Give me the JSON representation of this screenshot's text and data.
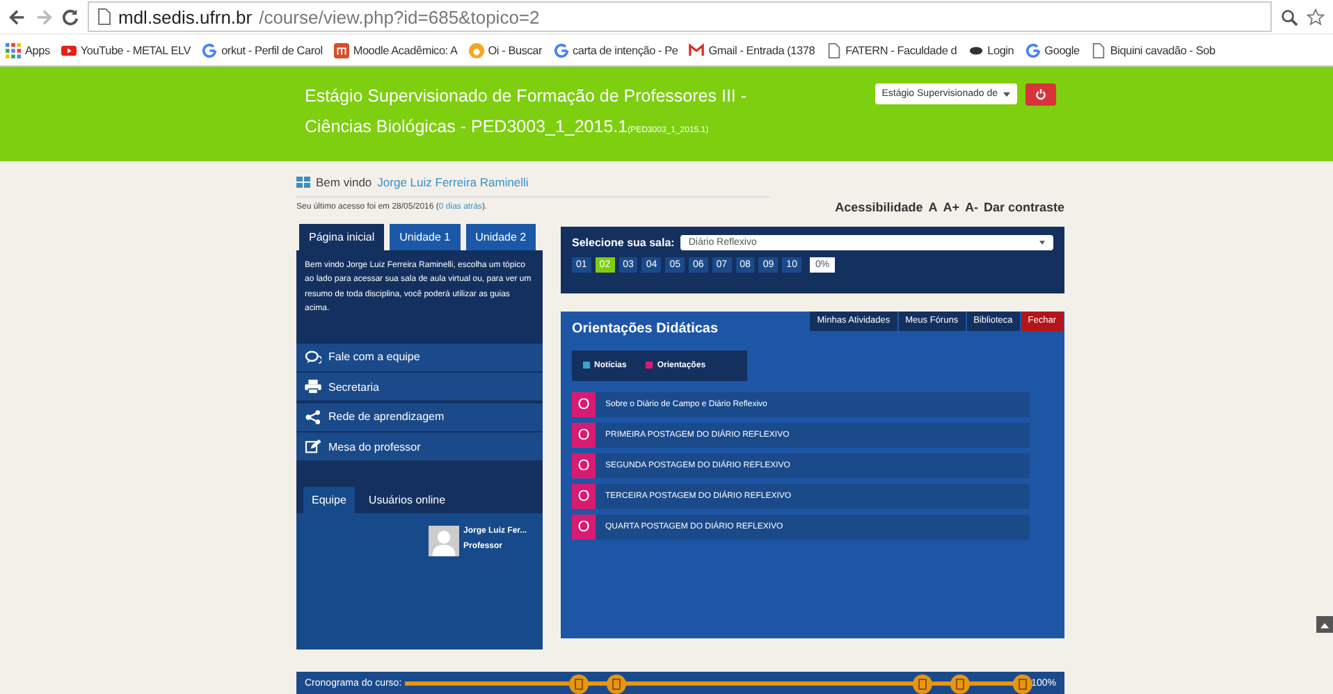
{
  "browser": {
    "url_host": "mdl.sedis.ufrn.br",
    "url_path": "/course/view.php?id=685&topico=2",
    "bookmarks": [
      {
        "kind": "apps",
        "label": "Apps"
      },
      {
        "kind": "youtube",
        "label": "YouTube - METAL ELV"
      },
      {
        "kind": "google",
        "label": "orkut - Perfil de Carol"
      },
      {
        "kind": "moodle",
        "label": "Moodle Acadêmico: A"
      },
      {
        "kind": "oi",
        "label": "Oi - Buscar"
      },
      {
        "kind": "google",
        "label": "carta de intenção - Pe"
      },
      {
        "kind": "gmail",
        "label": "Gmail - Entrada (1378"
      },
      {
        "kind": "page",
        "label": "FATERN - Faculdade d"
      },
      {
        "kind": "login",
        "label": "Login"
      },
      {
        "kind": "google",
        "label": "Google"
      },
      {
        "kind": "page",
        "label": "Biquini cavadão - Sob"
      }
    ]
  },
  "header": {
    "title": "Estágio Supervisionado de Formação de Professores III - Ciências Biológicas - PED3003_1_2015.1",
    "code": "(PED3003_1_2015.1)",
    "course_select": "Estágio Supervisionado de"
  },
  "welcome": {
    "prefix": "Bem vindo",
    "name": "Jorge Luiz Ferreira Raminelli",
    "last_access": "Seu último acesso foi em 28/05/2016 (",
    "last_access_link": "0 dias atrás",
    "last_access_end": ")."
  },
  "accessibility": [
    "Acessibilidade",
    "A",
    "A+",
    "A-",
    "Dar contraste"
  ],
  "left_tabs": [
    {
      "label": "Página inicial",
      "selected": true
    },
    {
      "label": "Unidade 1",
      "selected": false
    },
    {
      "label": "Unidade 2",
      "selected": false
    }
  ],
  "intro": "Bem vindo Jorge Luiz Ferreira Raminelli, escolha um tópico ao lado para acessar sua sala de aula virtual ou, para ver um resumo de toda disciplina, você poderá utilizar as guias acima.",
  "menu": [
    {
      "kind": "chat",
      "label": "Fale com a equipe"
    },
    {
      "kind": "print",
      "label": "Secretaria"
    },
    {
      "kind": "share",
      "label": "Rede de aprendizagem"
    },
    {
      "kind": "edit",
      "label": "Mesa do professor"
    }
  ],
  "people_tabs": [
    {
      "label": "Equipe",
      "selected": true
    },
    {
      "label": "Usuários online",
      "selected": false
    }
  ],
  "member": {
    "name": "Jorge Luiz Fer...",
    "role": "Professor"
  },
  "room": {
    "label": "Selecione sua sala:",
    "value": "Diário Reflexivo",
    "numbers": [
      {
        "label": "01",
        "selected": false
      },
      {
        "label": "02",
        "selected": true
      },
      {
        "label": "03",
        "selected": false
      },
      {
        "label": "04",
        "selected": false
      },
      {
        "label": "05",
        "selected": false
      },
      {
        "label": "06",
        "selected": false
      },
      {
        "label": "07",
        "selected": false
      },
      {
        "label": "08",
        "selected": false
      },
      {
        "label": "09",
        "selected": false
      },
      {
        "label": "10",
        "selected": false
      }
    ],
    "percent": "0%"
  },
  "orientations": {
    "title": "Orientações Didáticas",
    "tabs": [
      {
        "label": "Minhas Atividades",
        "kind": "link"
      },
      {
        "label": "Meus Fóruns",
        "kind": "link"
      },
      {
        "label": "Biblioteca",
        "kind": "link"
      },
      {
        "label": "Fechar",
        "kind": "close"
      }
    ],
    "legend": [
      {
        "label": "Notícias",
        "color": "#3aa3c9"
      },
      {
        "label": "Orientações",
        "color": "#d81b72"
      }
    ],
    "items": [
      {
        "badge": "O",
        "label": "Sobre o Diário de Campo e Diário Reflexivo",
        "color": "#d81b72"
      },
      {
        "badge": "O",
        "label": "PRIMEIRA POSTAGEM DO DIÁRIO REFLEXIVO",
        "color": "#d81b72"
      },
      {
        "badge": "O",
        "label": "SEGUNDA POSTAGEM DO DIÁRIO REFLEXIVO",
        "color": "#d81b72"
      },
      {
        "badge": "O",
        "label": "TERCEIRA POSTAGEM DO DIÁRIO REFLEXIVO",
        "color": "#d81b72"
      },
      {
        "badge": "O",
        "label": "QUARTA POSTAGEM DO DIÁRIO REFLEXIVO",
        "color": "#d81b72"
      }
    ]
  },
  "schedule": {
    "label": "Cronograma do curso:",
    "level": 1,
    "percent": "100%"
  }
}
